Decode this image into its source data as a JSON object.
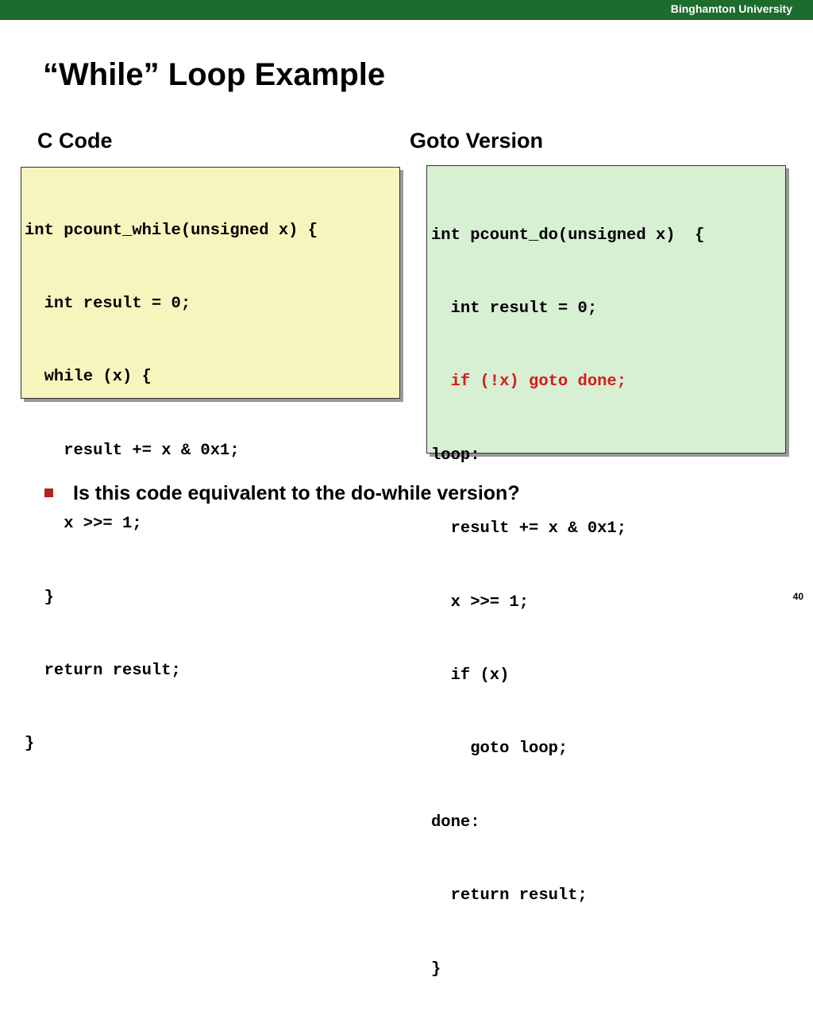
{
  "header": {
    "university": "Binghamton University"
  },
  "slide": {
    "title": "“While” Loop Example",
    "left_label": "C Code",
    "right_label": "Goto Version",
    "c_code": [
      "int pcount_while(unsigned x) {",
      "  int result = 0;",
      "  while (x) {",
      "    result += x & 0x1;",
      "    x >>= 1;",
      "  }",
      "  return result;",
      "}"
    ],
    "goto_code": [
      "int pcount_do(unsigned x)  {",
      "  int result = 0;",
      "  if (!x) goto done;",
      "loop:",
      "  result += x & 0x1;",
      "  x >>= 1;",
      "  if (x)",
      "    goto loop;",
      "done:",
      "  return result;",
      "}"
    ],
    "highlight_color": "#d91a1a",
    "bullet": "Is this code equivalent to the do-while version?",
    "page_number": "40"
  },
  "colors": {
    "header_bar": "#1e6b2e",
    "c_code_bg": "#f7f4bd",
    "goto_code_bg": "#d7efd3",
    "bullet_marker": "#b22222"
  }
}
